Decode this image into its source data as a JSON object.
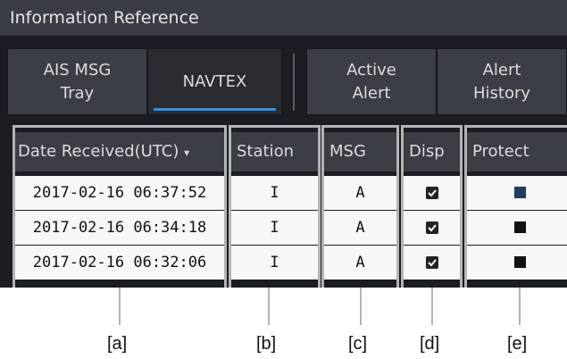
{
  "window": {
    "title": "Information Reference"
  },
  "tabs": [
    {
      "label": "AIS MSG\nTray",
      "active": false
    },
    {
      "label": "NAVTEX",
      "active": true
    },
    {
      "label": "Active\nAlert",
      "active": false
    },
    {
      "label": "Alert\nHistory",
      "active": false
    }
  ],
  "table": {
    "headers": [
      "Date Received(UTC)",
      "Station",
      "MSG",
      "Disp",
      "Protect"
    ],
    "sort_indicator": "▾",
    "rows": [
      {
        "date": "2017-02-16 06:37:52",
        "station": "I",
        "msg": "A",
        "disp": true,
        "protect": false
      },
      {
        "date": "2017-02-16 06:34:18",
        "station": "I",
        "msg": "A",
        "disp": true,
        "protect": false
      },
      {
        "date": "2017-02-16 06:32:06",
        "station": "I",
        "msg": "A",
        "disp": true,
        "protect": false
      }
    ]
  },
  "callouts": [
    "[a]",
    "[b]",
    "[c]",
    "[d]",
    "[e]"
  ],
  "colors": {
    "accent": "#3d8fd6",
    "background": "#1b1d22",
    "header": "#3b3e45"
  }
}
